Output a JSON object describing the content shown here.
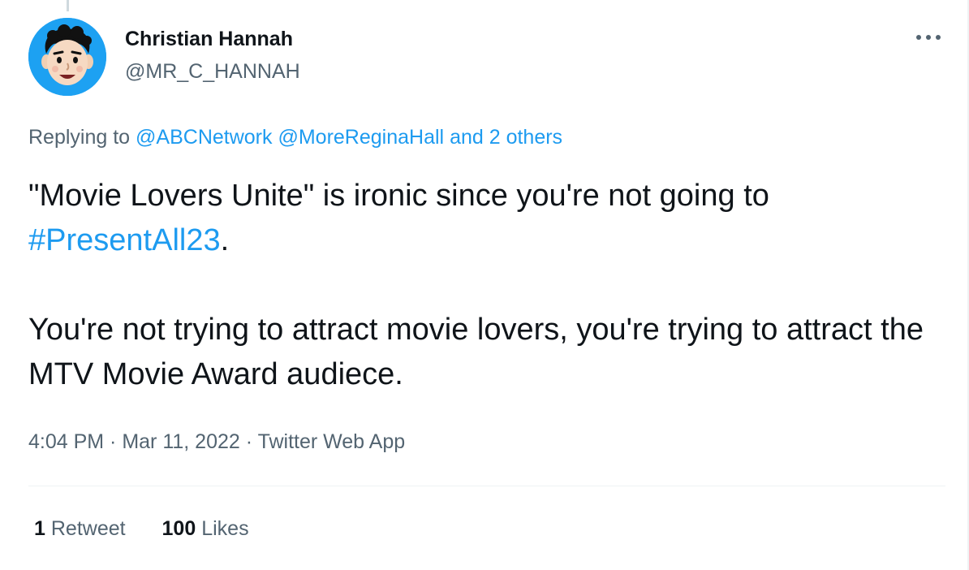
{
  "author": {
    "name": "Christian Hannah",
    "handle": "@MR_C_HANNAH",
    "avatar_icon": "cartoon-face-avatar",
    "avatar_bg": "#1da1f2"
  },
  "more_icon": "more-horizontal-icon",
  "reply": {
    "prefix": "Replying to",
    "mention_1": "@ABCNetwork",
    "mention_2": "@MoreReginaHall",
    "others": "and 2 others"
  },
  "tweet": {
    "line1_text": "\"Movie Lovers Unite\" is ironic since you're not going to",
    "hashtag": "#PresentAll23",
    "line2_tail": ".",
    "para2": "You're not trying to attract movie lovers, you're trying to attract the MTV Movie Award audiece."
  },
  "meta": {
    "time": "4:04 PM",
    "sep": " · ",
    "date": "Mar 11, 2022",
    "source": "Twitter Web App"
  },
  "stats": {
    "retweets_count": "1",
    "retweets_label": "Retweet",
    "likes_count": "100",
    "likes_label": "Likes"
  },
  "colors": {
    "link": "#1d9bf0",
    "secondary_text": "#536471",
    "primary_text": "#0f1419"
  }
}
